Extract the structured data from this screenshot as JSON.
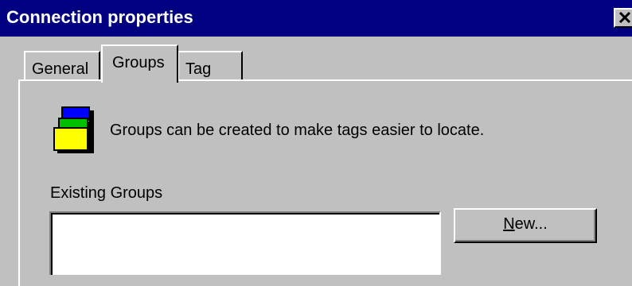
{
  "window": {
    "title": "Connection properties",
    "close_icon": "close-icon"
  },
  "tabs": [
    {
      "label": "General",
      "selected": false
    },
    {
      "label": "Groups",
      "selected": true
    },
    {
      "label": "Tag",
      "selected": false
    }
  ],
  "groups_page": {
    "icon": "stacked-groups-icon",
    "info_text": "Groups can be created to make tags easier to locate.",
    "existing_label": "Existing Groups",
    "existing_groups": [],
    "new_button": {
      "mnemonic": "N",
      "rest": "ew..."
    }
  },
  "colors": {
    "titlebar": "#000080",
    "face": "#c0c0c0",
    "icon_blue": "#0000ff",
    "icon_green": "#00c000",
    "icon_yellow": "#ffff00"
  }
}
